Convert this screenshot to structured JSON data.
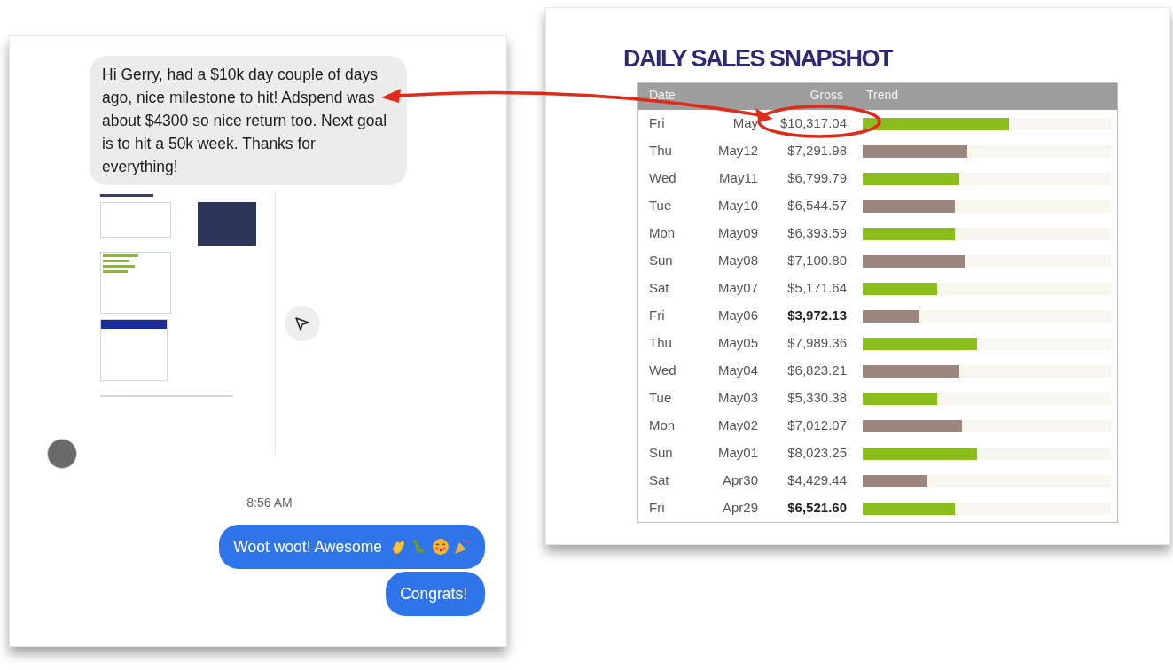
{
  "chat": {
    "incoming_message": "Hi Gerry, had a $10k day couple of days ago, nice milestone to hit! Adspend was about $4300 so nice return too. Next goal is to hit a 50k week. Thanks for everything!",
    "timestamp": "8:56 AM",
    "outgoing_messages": [
      {
        "text": "Woot woot! Awesome",
        "emojis": [
          {
            "kind": "clap"
          },
          {
            "kind": "dinosaur"
          },
          {
            "kind": "kiss"
          },
          {
            "kind": "party"
          }
        ]
      },
      {
        "text": "Congrats!"
      }
    ]
  },
  "sales": {
    "title": "DAILY SALES SNAPSHOT",
    "columns": [
      "Date",
      "Gross",
      "Trend"
    ],
    "rows": [
      {
        "day": "Fri",
        "date": "May",
        "gross": "$10,317.04",
        "bold": false,
        "level": 0.59,
        "color": "#8bbd1d"
      },
      {
        "day": "Thu",
        "date": "May12",
        "gross": "$7,291.98",
        "bold": false,
        "level": 0.42,
        "color": "#9c8780"
      },
      {
        "day": "Wed",
        "date": "May11",
        "gross": "$6,799.79",
        "bold": false,
        "level": 0.39,
        "color": "#8bbd1d"
      },
      {
        "day": "Tue",
        "date": "May10",
        "gross": "$6,544.57",
        "bold": false,
        "level": 0.37,
        "color": "#9c8780"
      },
      {
        "day": "Mon",
        "date": "May09",
        "gross": "$6,393.59",
        "bold": false,
        "level": 0.37,
        "color": "#8bbd1d"
      },
      {
        "day": "Sun",
        "date": "May08",
        "gross": "$7,100.80",
        "bold": false,
        "level": 0.41,
        "color": "#9c8780"
      },
      {
        "day": "Sat",
        "date": "May07",
        "gross": "$5,171.64",
        "bold": false,
        "level": 0.3,
        "color": "#8bbd1d"
      },
      {
        "day": "Fri",
        "date": "May06",
        "gross": "$3,972.13",
        "bold": true,
        "level": 0.23,
        "color": "#9c8780"
      },
      {
        "day": "Thu",
        "date": "May05",
        "gross": "$7,989.36",
        "bold": false,
        "level": 0.46,
        "color": "#8bbd1d"
      },
      {
        "day": "Wed",
        "date": "May04",
        "gross": "$6,823.21",
        "bold": false,
        "level": 0.39,
        "color": "#9c8780"
      },
      {
        "day": "Tue",
        "date": "May03",
        "gross": "$5,330.38",
        "bold": false,
        "level": 0.3,
        "color": "#8bbd1d"
      },
      {
        "day": "Mon",
        "date": "May02",
        "gross": "$7,012.07",
        "bold": false,
        "level": 0.4,
        "color": "#9c8780"
      },
      {
        "day": "Sun",
        "date": "May01",
        "gross": "$8,023.25",
        "bold": false,
        "level": 0.46,
        "color": "#8bbd1d"
      },
      {
        "day": "Sat",
        "date": "Apr30",
        "gross": "$4,429.44",
        "bold": false,
        "level": 0.26,
        "color": "#9c8780"
      },
      {
        "day": "Fri",
        "date": "Apr29",
        "gross": "$6,521.60",
        "bold": true,
        "level": 0.37,
        "color": "#8bbd1d"
      }
    ]
  }
}
